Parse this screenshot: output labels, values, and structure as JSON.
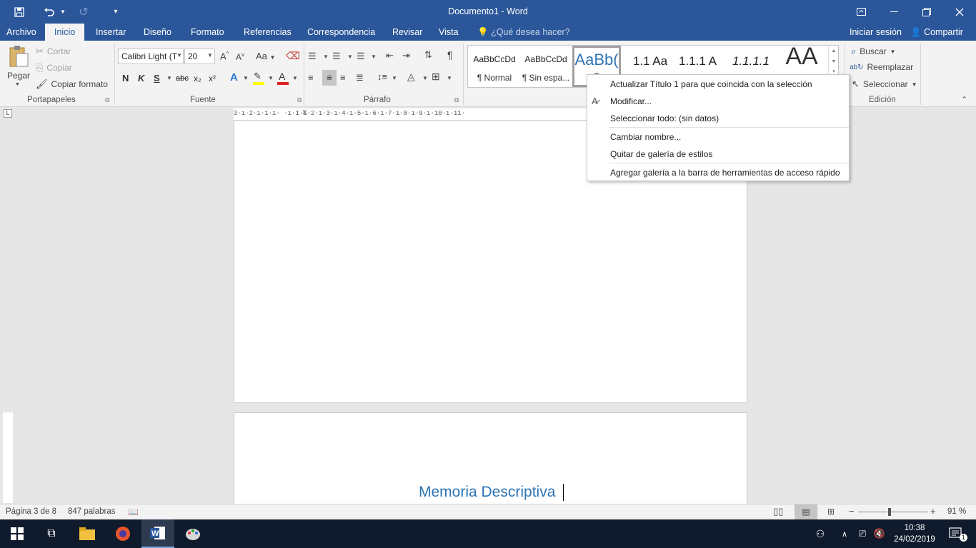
{
  "window": {
    "title": "Documento1 - Word"
  },
  "tabs": [
    {
      "label": "Archivo"
    },
    {
      "label": "Inicio"
    },
    {
      "label": "Insertar"
    },
    {
      "label": "Diseño"
    },
    {
      "label": "Formato"
    },
    {
      "label": "Referencias"
    },
    {
      "label": "Correspondencia"
    },
    {
      "label": "Revisar"
    },
    {
      "label": "Vista"
    }
  ],
  "tell_me": "¿Qué desea hacer?",
  "account": {
    "signin": "Iniciar sesión",
    "share": "Compartir"
  },
  "clipboard": {
    "paste": "Pegar",
    "cut": "Cortar",
    "copy": "Copiar",
    "format_painter": "Copiar formato",
    "group": "Portapapeles"
  },
  "font": {
    "name": "Calibri Light (T",
    "size": "20",
    "group": "Fuente",
    "bold": "N",
    "italic": "K",
    "underline": "S",
    "strike": "abc",
    "sub": "x₂",
    "sup": "x²",
    "case": "Aa",
    "grow": "A",
    "shrink": "A"
  },
  "paragraph": {
    "group": "Párrafo"
  },
  "styles": {
    "items": [
      {
        "preview": "AaBbCcDd",
        "name": "¶ Normal"
      },
      {
        "preview": "AaBbCcDd",
        "name": "¶ Sin espa..."
      },
      {
        "preview": "AaBb(",
        "name": "T"
      },
      {
        "preview": "1.1  Aa",
        "name": ""
      },
      {
        "preview": "1.1.1  A",
        "name": ""
      },
      {
        "preview": "1.1.1.1",
        "name": ""
      },
      {
        "preview": "AA",
        "name": ""
      }
    ]
  },
  "editing": {
    "find": "Buscar",
    "replace": "Reemplazar",
    "select": "Seleccionar",
    "group": "Edición"
  },
  "ruler": {
    "text": "3·ı·2·ı·1·ı· ·ı·1·ı·2·ı·3·ı·4·ı·5·ı·6·ı·7·ı·8·ı·9·ı·10·ı·11·"
  },
  "context_menu": {
    "items": [
      {
        "label": "Actualizar Título 1 para que coincida con la selección"
      },
      {
        "label": "Modificar..."
      },
      {
        "label": "Seleccionar todo: (sin datos)"
      },
      {
        "label": "Cambiar nombre..."
      },
      {
        "label": "Quitar de galería de estilos"
      },
      {
        "label": "Agregar galería a la barra de herramientas de acceso rápido"
      }
    ]
  },
  "document": {
    "heading": "Memoria Descriptiva"
  },
  "status": {
    "page": "Página 3 de 8",
    "words": "847 palabras",
    "zoom": "91 %",
    "zoom_value": 91
  },
  "taskbar": {
    "time": "10:38",
    "date": "24/02/2019",
    "notifications": "1"
  },
  "colors": {
    "accent": "#2b579a",
    "heading": "#2e74b5",
    "taskbar": "#0f1a2c"
  }
}
